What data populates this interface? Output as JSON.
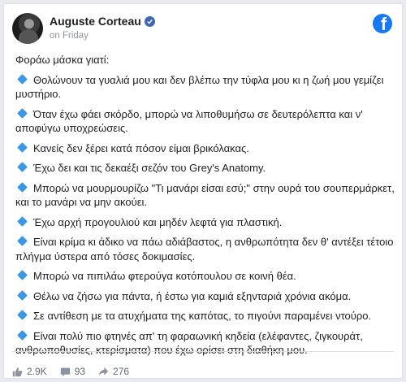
{
  "post": {
    "author": "Auguste Corteau",
    "timestamp": "on Friday",
    "intro": "Φοράω μάσκα γιατί:",
    "items": [
      "Θολώνουν τα γυαλιά μου και δεν βλέπω την τύφλα μου κι η ζωή μου γεμίζει μυστήριο.",
      "Όταν έχω φάει σκόρδο, μπορώ να λιποθυμήσω σε δευτερόλεπτα και ν' αποφύγω υποχρεώσεις.",
      "Κανείς δεν ξέρει κατά πόσον είμαι βρικόλακας.",
      "Έχω δει και τις δεκαέξι σεζόν του Grey's Anatomy.",
      "Μπορώ να μουρμουρίζω \"Τι μανάρι είσαι εσύ;\" στην ουρά του σουπερμάρκετ, και το μανάρι να μην ακούει.",
      "Έχω αρχή προγουλιού και μηδέν λεφτά για πλαστική.",
      "Είναι κρίμα κι άδικο να πάω αδιάβαστος, η ανθρωπότητα δεν θ' αντέξει τέτοιο πλήγμα ύστερα από τόσες δοκιμασίες.",
      "Μπορώ να πιπιλάω φτερούγα κοτόπουλου σε κοινή θέα.",
      "Θέλω να ζήσω για πάντα, ή έστω για καμιά εξηνταριά χρόνια ακόμα.",
      "Σε αντίθεση με τα ατυχήματα της καπότας, το πιγούνι παραμένει ντούρο.",
      "Είναι πολύ πιο φτηνές απ' τη φαραωνική κηδεία (ελέφαντες, ζιγκουράτ, ανθρωποθυσίες, κτερίσματα) που έχω ορίσει στη διαθήκη μου."
    ]
  },
  "stats": {
    "likes": "2.9K",
    "comments": "93",
    "shares": "276"
  },
  "icons": {
    "bullet": "small-blue-diamond-icon",
    "brand": "facebook-logo-icon",
    "likes": "thumbs-up-icon",
    "comments": "comment-icon",
    "shares": "share-icon"
  },
  "colors": {
    "brand": "#1877f2",
    "bullet": "#3a98e6",
    "text": "#1c1e21",
    "muted": "#90949c"
  }
}
